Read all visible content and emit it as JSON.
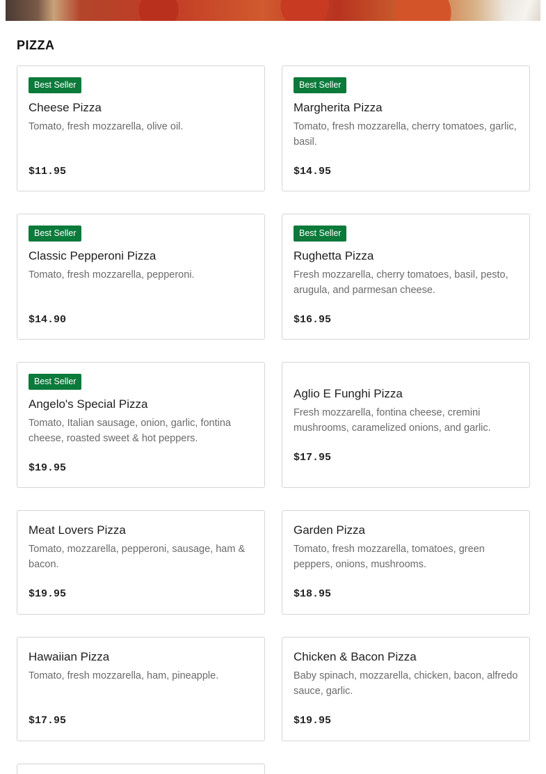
{
  "section": {
    "title": "PIZZA"
  },
  "colors": {
    "badge_bg": "#0b7a3b",
    "border": "#d4d4d4"
  },
  "items": [
    {
      "badge": "Best Seller",
      "name": "Cheese Pizza",
      "description": "Tomato, fresh mozzarella, olive oil.",
      "price": "$11.95"
    },
    {
      "badge": "Best Seller",
      "name": "Margherita Pizza",
      "description": "Tomato, fresh mozzarella, cherry tomatoes, garlic, basil.",
      "price": "$14.95"
    },
    {
      "badge": "Best Seller",
      "name": "Classic Pepperoni Pizza",
      "description": "Tomato, fresh mozzarella, pepperoni.",
      "price": "$14.90"
    },
    {
      "badge": "Best Seller",
      "name": "Rughetta Pizza",
      "description": "Fresh mozzarella, cherry tomatoes, basil, pesto, arugula, and parmesan cheese.",
      "price": "$16.95"
    },
    {
      "badge": "Best Seller",
      "name": "Angelo's Special Pizza",
      "description": "Tomato, Italian sausage, onion, garlic, fontina cheese, roasted sweet & hot peppers.",
      "price": "$19.95"
    },
    {
      "name": "Aglio E Funghi Pizza",
      "description": "Fresh mozzarella, fontina cheese, cremini mushrooms, caramelized onions, and garlic.",
      "price": "$17.95"
    },
    {
      "name": "Meat Lovers Pizza",
      "description": "Tomato, mozzarella, pepperoni, sausage, ham & bacon.",
      "price": "$19.95"
    },
    {
      "name": "Garden Pizza",
      "description": "Tomato, fresh mozzarella, tomatoes, green peppers, onions, mushrooms.",
      "price": "$18.95"
    },
    {
      "name": "Hawaiian Pizza",
      "description": "Tomato, fresh mozzarella, ham, pineapple.",
      "price": "$17.95"
    },
    {
      "name": "Chicken & Bacon Pizza",
      "description": "Baby spinach, mozzarella, chicken, bacon, alfredo sauce, garlic.",
      "price": "$19.95"
    }
  ]
}
